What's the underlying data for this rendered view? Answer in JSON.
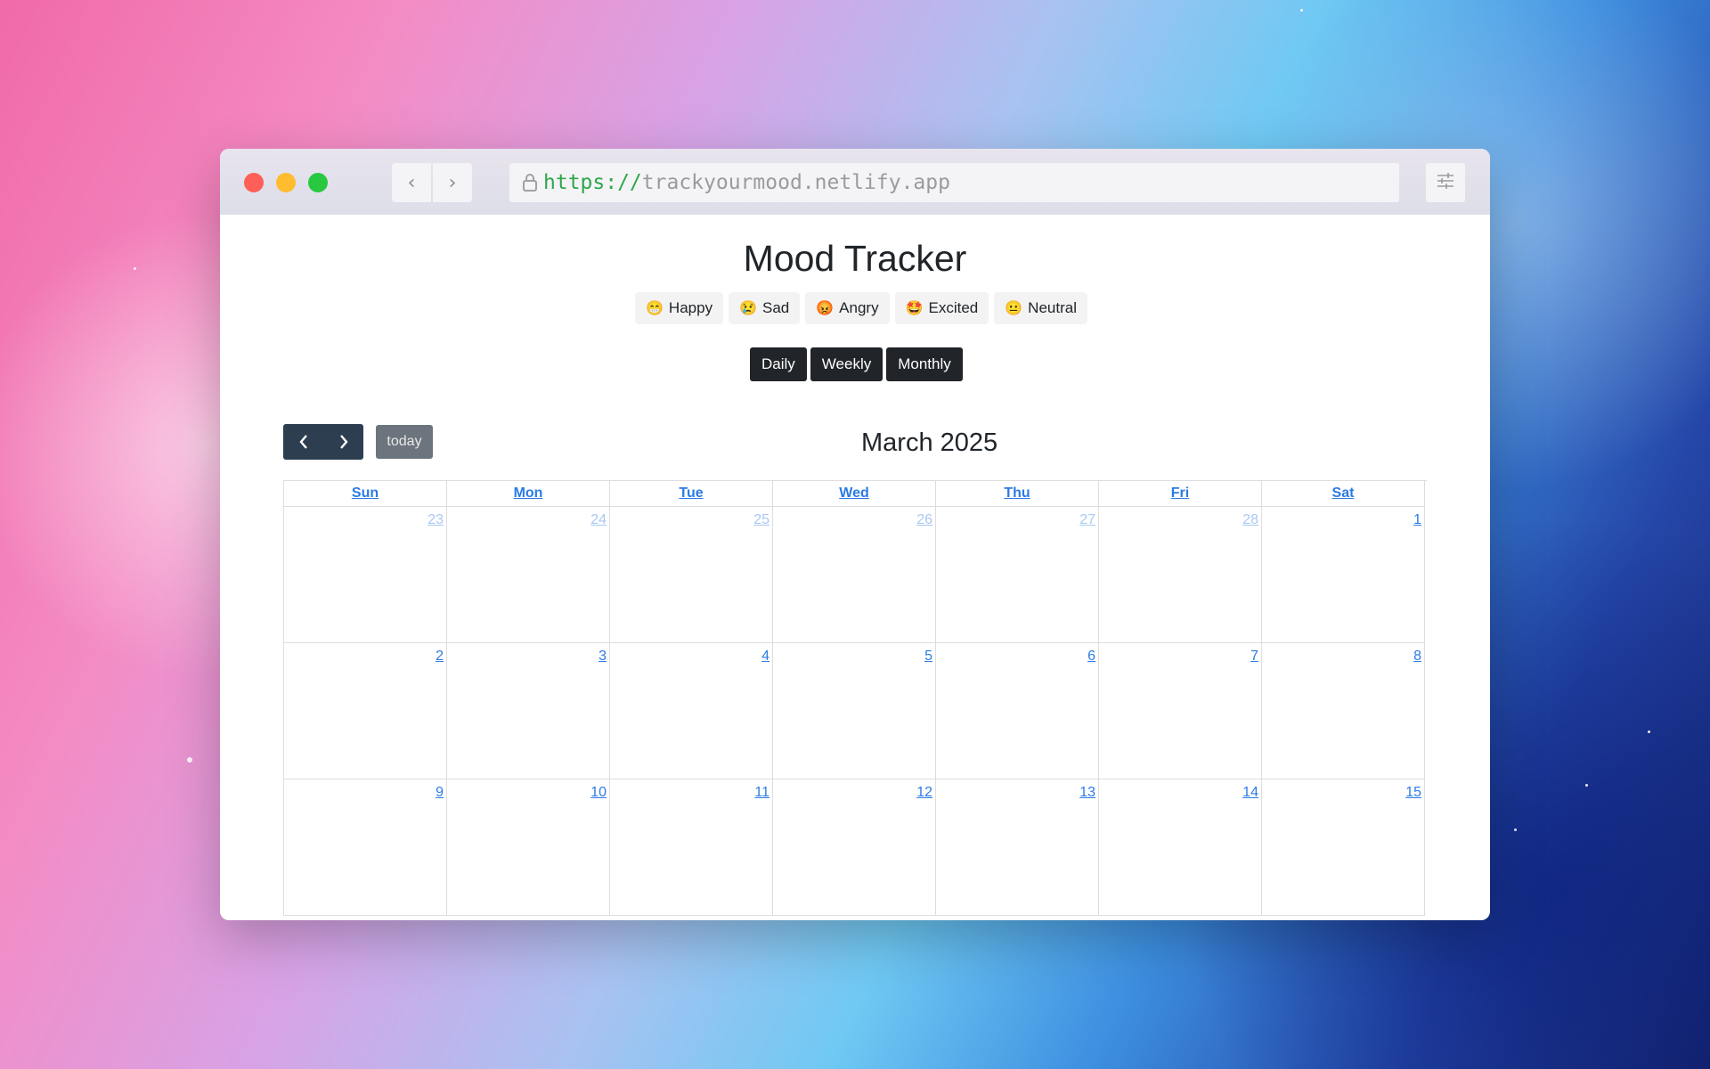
{
  "browser": {
    "url_scheme": "https://",
    "url_host": "trackyourmood.netlify.app"
  },
  "app": {
    "title": "Mood Tracker",
    "moods": [
      {
        "emoji": "😁",
        "label": "Happy"
      },
      {
        "emoji": "😢",
        "label": "Sad"
      },
      {
        "emoji": "😡",
        "label": "Angry"
      },
      {
        "emoji": "🤩",
        "label": "Excited"
      },
      {
        "emoji": "😐",
        "label": "Neutral"
      }
    ],
    "views": [
      "Daily",
      "Weekly",
      "Monthly"
    ]
  },
  "calendar": {
    "today_label": "today",
    "month_title": "March 2025",
    "weekdays": [
      "Sun",
      "Mon",
      "Tue",
      "Wed",
      "Thu",
      "Fri",
      "Sat"
    ],
    "weeks": [
      [
        {
          "d": "23",
          "other": true
        },
        {
          "d": "24",
          "other": true
        },
        {
          "d": "25",
          "other": true
        },
        {
          "d": "26",
          "other": true
        },
        {
          "d": "27",
          "other": true
        },
        {
          "d": "28",
          "other": true
        },
        {
          "d": "1",
          "other": false
        }
      ],
      [
        {
          "d": "2",
          "other": false
        },
        {
          "d": "3",
          "other": false
        },
        {
          "d": "4",
          "other": false
        },
        {
          "d": "5",
          "other": false
        },
        {
          "d": "6",
          "other": false
        },
        {
          "d": "7",
          "other": false
        },
        {
          "d": "8",
          "other": false
        }
      ],
      [
        {
          "d": "9",
          "other": false
        },
        {
          "d": "10",
          "other": false
        },
        {
          "d": "11",
          "other": false
        },
        {
          "d": "12",
          "other": false
        },
        {
          "d": "13",
          "other": false
        },
        {
          "d": "14",
          "other": false
        },
        {
          "d": "15",
          "other": false
        }
      ]
    ]
  }
}
